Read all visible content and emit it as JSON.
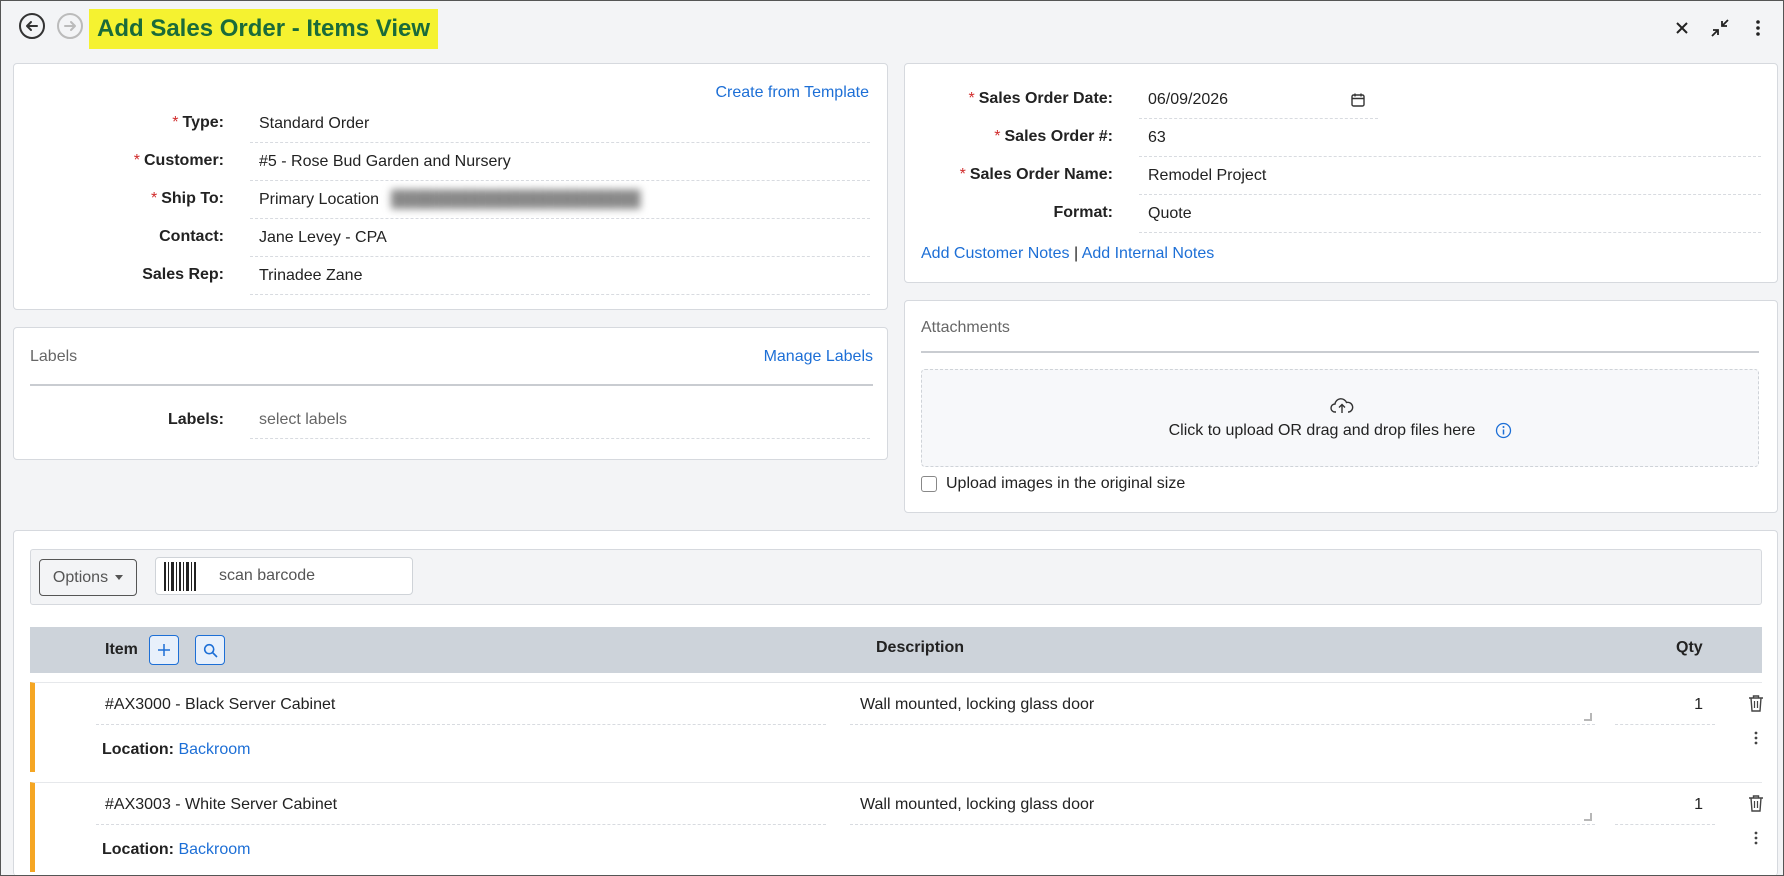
{
  "header": {
    "title": "Add Sales Order - Items View"
  },
  "order_info": {
    "template_link": "Create from Template",
    "fields": [
      {
        "label": "Type:",
        "required": true,
        "value": "Standard Order"
      },
      {
        "label": "Customer:",
        "required": true,
        "value": "#5 - Rose Bud Garden and Nursery"
      },
      {
        "label": "Ship To:",
        "required": true,
        "value": "Primary Location"
      },
      {
        "label": "Contact:",
        "required": false,
        "value": "Jane Levey - CPA"
      },
      {
        "label": "Sales Rep:",
        "required": false,
        "value": "Trinadee Zane"
      }
    ]
  },
  "labels_section": {
    "title": "Labels",
    "manage_link": "Manage Labels",
    "field_label": "Labels:",
    "placeholder": "select labels"
  },
  "order_details": {
    "fields": [
      {
        "label": "Sales Order Date:",
        "required": true,
        "value": "06/09/2026"
      },
      {
        "label": "Sales Order #:",
        "required": true,
        "value": "63"
      },
      {
        "label": "Sales Order Name:",
        "required": true,
        "value": "Remodel Project"
      },
      {
        "label": "Format:",
        "required": false,
        "value": "Quote"
      }
    ],
    "customer_notes_link": "Add Customer Notes",
    "separator": "|",
    "internal_notes_link": "Add Internal Notes"
  },
  "attachments": {
    "title": "Attachments",
    "upload_text": "Click to upload OR drag and drop files here",
    "checkbox_label": "Upload images in the original size"
  },
  "items": {
    "options_label": "Options",
    "scan_placeholder": "scan barcode",
    "columns": {
      "item": "Item",
      "description": "Description",
      "qty": "Qty"
    },
    "location_label": "Location:",
    "rows": [
      {
        "item": "#AX3000 - Black Server Cabinet",
        "description": "Wall mounted, locking glass door",
        "qty": "1",
        "location": "Backroom"
      },
      {
        "item": "#AX3003 - White Server Cabinet",
        "description": "Wall mounted, locking glass door",
        "qty": "1",
        "location": "Backroom"
      }
    ]
  },
  "colors": {
    "title_highlight": "#f5f230",
    "title_text": "#1a6b3a",
    "link": "#1d6fd6",
    "required": "#d02b2b",
    "row_accent": "#f5a623"
  },
  "icons": [
    "back-arrow-icon",
    "forward-arrow-icon",
    "close-icon",
    "collapse-icon",
    "kebab-menu-icon",
    "calendar-icon",
    "upload-cloud-icon",
    "info-icon",
    "barcode-icon",
    "plus-icon",
    "search-icon",
    "trash-icon"
  ]
}
